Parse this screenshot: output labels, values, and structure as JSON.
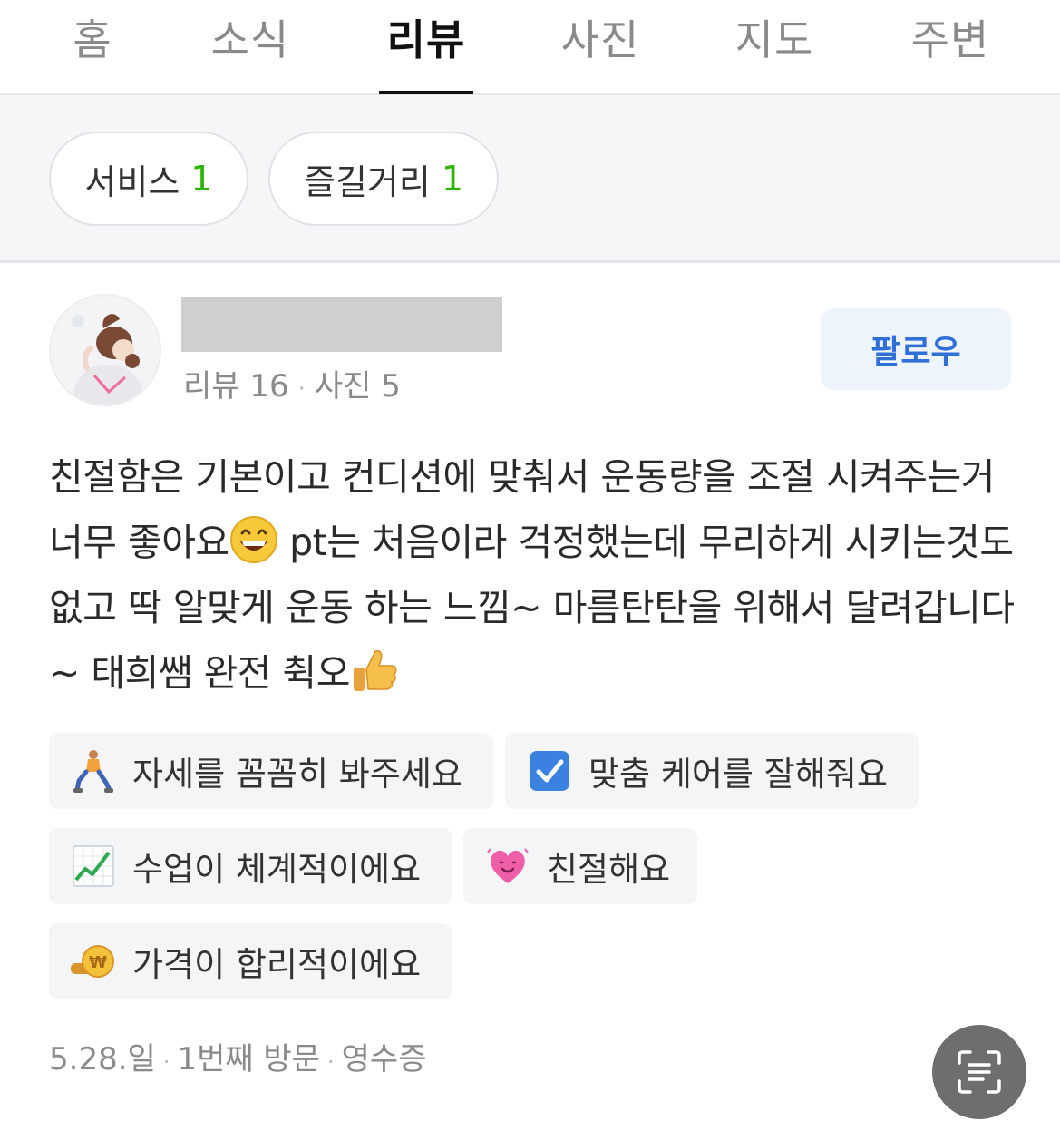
{
  "tabs": [
    {
      "label": "홈"
    },
    {
      "label": "소식"
    },
    {
      "label": "리뷰"
    },
    {
      "label": "사진"
    },
    {
      "label": "지도"
    },
    {
      "label": "주변"
    }
  ],
  "active_tab": "리뷰",
  "filters": [
    {
      "label": "서비스",
      "count": "1"
    },
    {
      "label": "즐길거리",
      "count": "1"
    }
  ],
  "reviewer": {
    "meta_reviews": "리뷰 16",
    "meta_photos": "사진 5",
    "follow_label": "팔로우"
  },
  "review": {
    "text_part1": "친절함은 기본이고 컨디션에 맞춰서 운동량을 조절 시켜주는거 너무 좋아요",
    "text_part2": " pt는 처음이라 걱정했는데 무리하게 시키는것도 없고 딱 알맞게 운동 하는 느낌~ 마름탄탄을 위해서 달려갑니다~ 태희쌤 완전 췩오"
  },
  "tags": [
    {
      "label": "자세를 꼼꼼히 봐주세요",
      "icon": "lunge-person-icon"
    },
    {
      "label": "맞춤 케어를 잘해줘요",
      "icon": "checkbox-icon"
    },
    {
      "label": "수업이 체계적이에요",
      "icon": "chart-increasing-icon"
    },
    {
      "label": "친절해요",
      "icon": "growing-heart-icon"
    },
    {
      "label": "가격이 합리적이에요",
      "icon": "won-coin-icon"
    }
  ],
  "footer": {
    "date": "5.28.일",
    "visit": "1번째 방문",
    "verification": "영수증"
  },
  "colors": {
    "accent_green": "#2db400",
    "follow_blue": "#2f6fd8",
    "fab_gray": "#6e6e6e"
  }
}
